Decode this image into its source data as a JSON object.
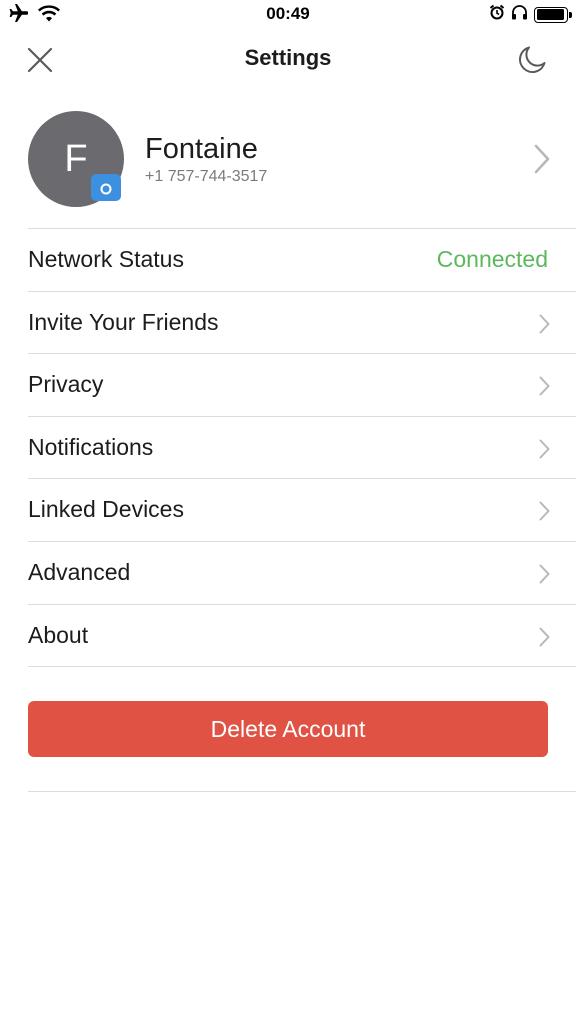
{
  "status_bar": {
    "time": "00:49",
    "icons": [
      "airplane-icon",
      "wifi-icon",
      "alarm-icon",
      "headphones-icon",
      "battery-icon"
    ],
    "battery_level": 0.95
  },
  "nav": {
    "title": "Settings",
    "close_icon": "close-icon",
    "theme_icon": "moon-icon"
  },
  "profile": {
    "initial": "F",
    "name": "Fontaine",
    "phone": "+1 757-744-3517",
    "avatar_color": "#6a6a6f",
    "camera_badge_color": "#3d8fe0"
  },
  "rows": [
    {
      "label": "Network Status",
      "status": "Connected"
    },
    {
      "label": "Invite Your Friends"
    },
    {
      "label": "Privacy"
    },
    {
      "label": "Notifications"
    },
    {
      "label": "Linked Devices"
    },
    {
      "label": "Advanced"
    },
    {
      "label": "About"
    }
  ],
  "delete_button": {
    "label": "Delete Account",
    "color": "#e05344"
  },
  "colors": {
    "connected": "#5cb85c",
    "divider": "#dcdcdf",
    "chevron": "#b8b8bc"
  }
}
